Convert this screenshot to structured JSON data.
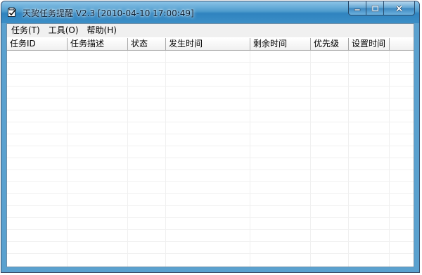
{
  "window": {
    "title": "天巭任务提醒 V2.3 [2010-04-10 17:00:49]"
  },
  "menu": {
    "items": [
      "任务(T)",
      "工具(O)",
      "帮助(H)"
    ]
  },
  "table": {
    "columns": [
      "任务ID",
      "任务描述",
      "状态",
      "发生时间",
      "剩余时间",
      "优先级",
      "设置时间"
    ],
    "rows": []
  },
  "colors": {
    "titlebar": "#4f9ccd",
    "menubar": "#f0f0f0",
    "gridline": "#f0f0f0"
  },
  "icons": {
    "app": "notepad-check-icon",
    "minimize": "minimize-icon",
    "maximize": "maximize-icon",
    "close": "close-icon"
  }
}
